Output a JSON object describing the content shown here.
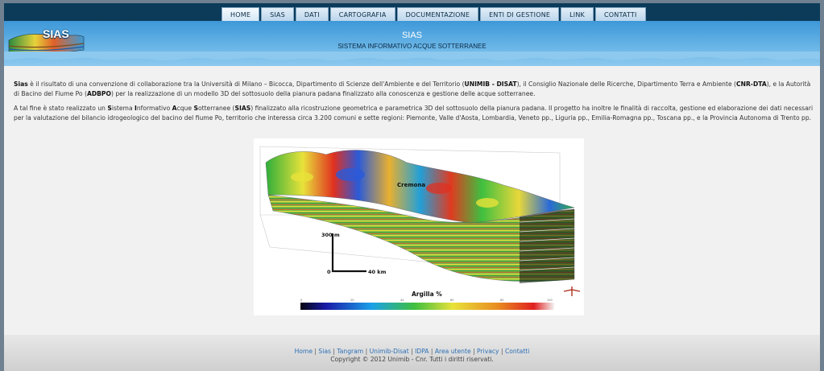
{
  "nav": {
    "items": [
      {
        "label": "HOME"
      },
      {
        "label": "SIAS"
      },
      {
        "label": "DATI"
      },
      {
        "label": "CARTOGRAFIA"
      },
      {
        "label": "DOCUMENTAZIONE"
      },
      {
        "label": "ENTI DI GESTIONE"
      },
      {
        "label": "LINK"
      },
      {
        "label": "CONTATTI"
      }
    ],
    "active_index": 0
  },
  "header": {
    "logo_text": "SIAS",
    "title": "SIAS",
    "subtitle": "SISTEMA INFORMATIVO ACQUE SOTTERRANEE"
  },
  "content": {
    "p1": {
      "sias": "Sias",
      "t1": " è il risultato di una convenzione di collaborazione tra la Università di Milano – Bicocca, Dipartimento di Scienze dell'Ambiente e del Territorio (",
      "unimib": "UNIMIB - DISAT",
      "t2": "), il Consiglio Nazionale delle Ricerche, Dipartimento Terra e Ambiente (",
      "cnr": "CNR-DTA",
      "t3": "), e la Autorità di Bacino del Fiume Po (",
      "adbpo": "ADBPO",
      "t4": ") per la realizzazione di un modello 3D del sottosuolo della pianura padana finalizzato alla conoscenza e gestione delle acque sotterranee."
    },
    "p2": {
      "t1": "A tal fine è stato realizzato un ",
      "s": "S",
      "t2": "istema ",
      "i": "I",
      "t3": "nformativo ",
      "a": "A",
      "t4": "cque ",
      "s2": "S",
      "t5": "otterranee (",
      "sias": "SIAS",
      "t6": ") finalizzato alla ricostruzione geometrica e parametrica 3D del sottosuolo della pianura padana. Il progetto ha inoltre le finalità di raccolta, gestione ed elaborazione dei dati necessari per la valutazione del bilancio idrogeologico del bacino del fiume Po, territorio che interessa circa 3.200 comuni e sette regioni: Piemonte, Valle d'Aosta, Lombardia, Veneto pp., Liguria pp., Emilia-Romagna pp., Toscana pp., e la Provincia Autonoma di Trento pp."
    }
  },
  "figure": {
    "city_label": "Cremona",
    "vertical_scale": "300 m",
    "origin": "0",
    "horizontal_scale": "40 km",
    "legend_title": "Argilla %",
    "legend_ticks": [
      "0",
      "20",
      "40",
      "60",
      "80",
      "100"
    ],
    "colors": {
      "low": "#1a1aa8",
      "mid": "#3fbf3f",
      "high": "#e02020"
    }
  },
  "footer": {
    "links": [
      "Home",
      "Sias",
      "Tangram",
      "Unimib-Disat",
      "IDPA",
      "Area utente",
      "Privacy",
      "Contatti"
    ],
    "separator": " | ",
    "copyright": "Copyright © 2012 Unimib - Cnr. Tutti i diritti riservati."
  }
}
